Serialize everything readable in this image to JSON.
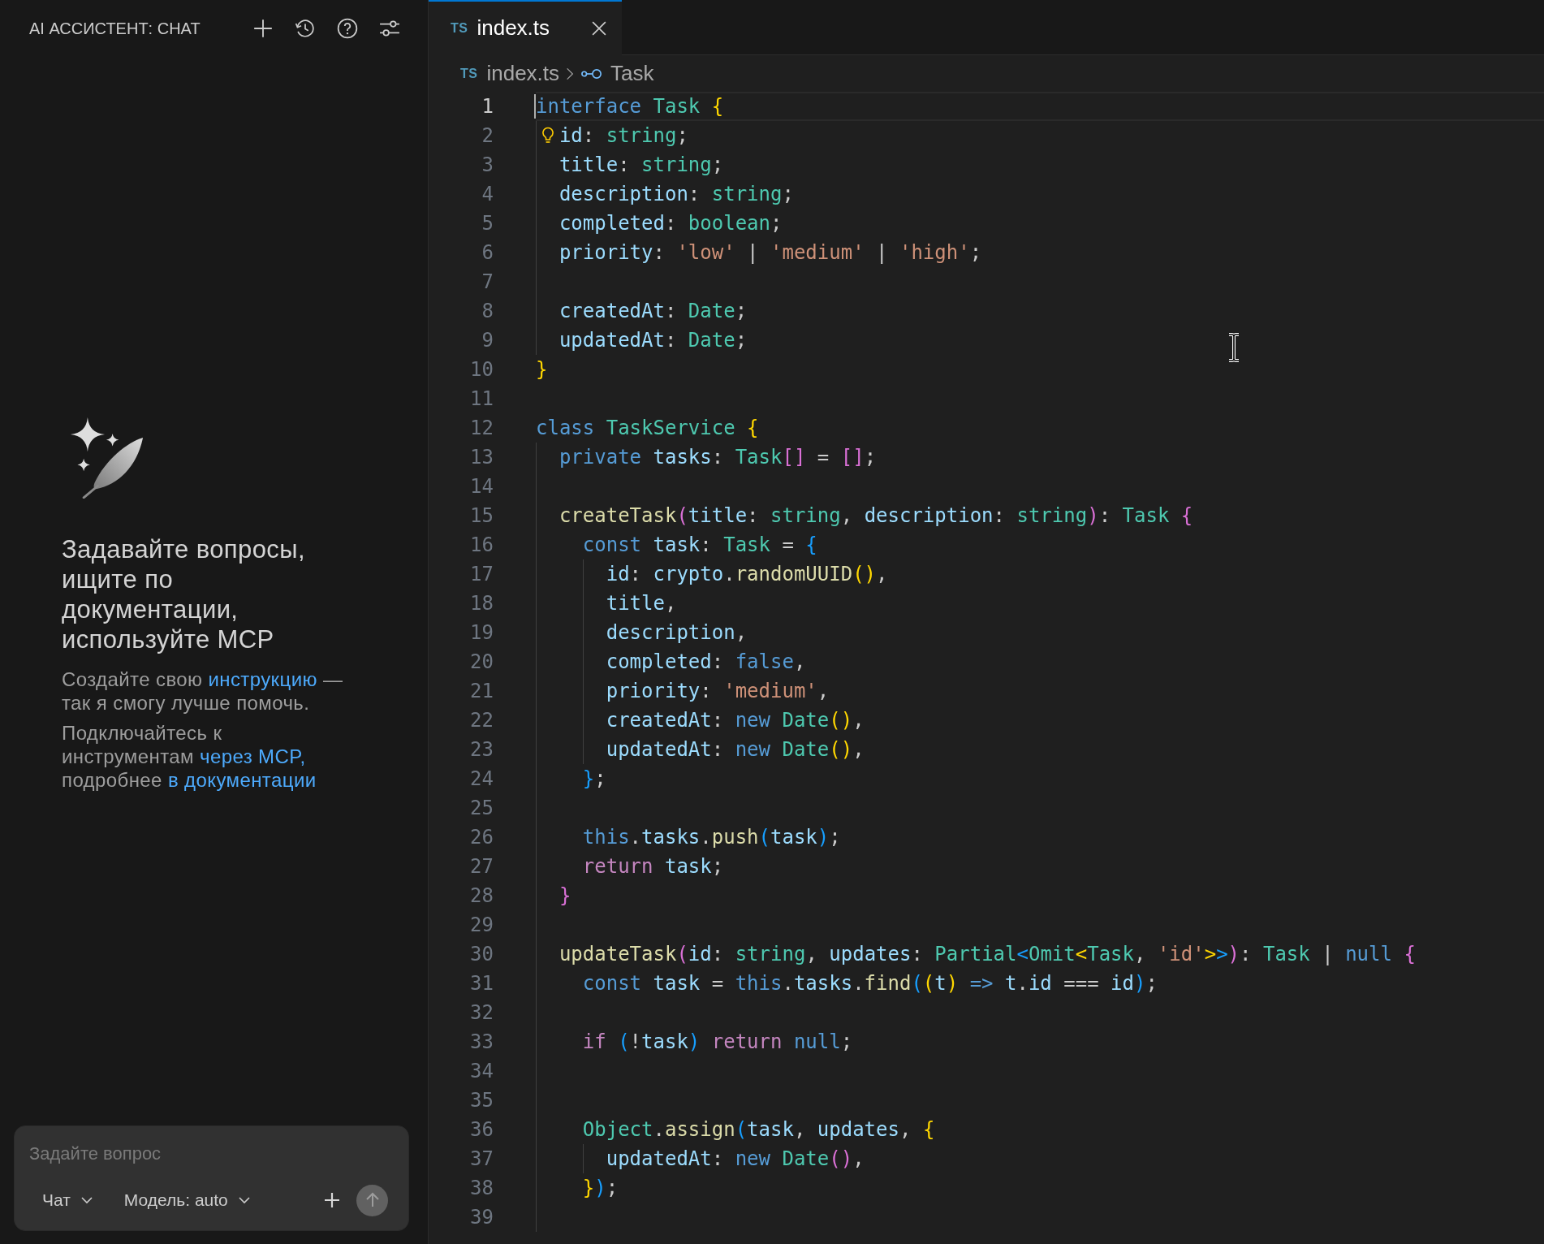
{
  "chat_panel": {
    "title": "AI АССИСТЕНТ: CHAT",
    "welcome": {
      "heading": "Задавайте вопросы, ищите по документации, используйте MCP",
      "paragraphs": [
        [
          {
            "kind": "text",
            "text": "Создайте свою "
          },
          {
            "kind": "link",
            "text": "инструкцию"
          },
          {
            "kind": "text",
            "text": " — так я смогу лучше помочь."
          }
        ],
        [
          {
            "kind": "text",
            "text": "Подключайтесь к инструментам "
          },
          {
            "kind": "link",
            "text": "через MCP,"
          },
          {
            "kind": "text",
            "text": " подробнее "
          },
          {
            "kind": "link",
            "text": "в документации"
          }
        ]
      ]
    },
    "composer": {
      "placeholder": "Задайте вопрос",
      "mode": "Чат",
      "model": "Модель: auto",
      "send_button": {
        "disabled": true
      }
    }
  },
  "editor": {
    "tabs": [
      {
        "file_type": "TS",
        "title": "index.ts",
        "selected": true
      }
    ],
    "breadcrumbs": [
      {
        "kind": "file",
        "file_type": "TS",
        "text": "index.ts"
      },
      {
        "kind": "symbol",
        "text": "Task"
      }
    ],
    "lines": [
      {
        "number": "1",
        "current": true,
        "lightbulb": false,
        "tokens": [
          {
            "kind": "keyword",
            "text": "interface "
          },
          {
            "kind": "type",
            "text": "Task "
          },
          {
            "kind": "bracket1",
            "text": "{"
          }
        ]
      },
      {
        "number": "2",
        "current": false,
        "lightbulb": true,
        "tokens": [
          {
            "kind": "variable",
            "text": "  id"
          },
          {
            "kind": "punct",
            "text": ": "
          },
          {
            "kind": "type",
            "text": "string"
          },
          {
            "kind": "punct",
            "text": ";"
          }
        ]
      },
      {
        "number": "3",
        "current": false,
        "lightbulb": false,
        "tokens": [
          {
            "kind": "variable",
            "text": "  title"
          },
          {
            "kind": "punct",
            "text": ": "
          },
          {
            "kind": "type",
            "text": "string"
          },
          {
            "kind": "punct",
            "text": ";"
          }
        ]
      },
      {
        "number": "4",
        "current": false,
        "lightbulb": false,
        "tokens": [
          {
            "kind": "variable",
            "text": "  description"
          },
          {
            "kind": "punct",
            "text": ": "
          },
          {
            "kind": "type",
            "text": "string"
          },
          {
            "kind": "punct",
            "text": ";"
          }
        ]
      },
      {
        "number": "5",
        "current": false,
        "lightbulb": false,
        "tokens": [
          {
            "kind": "variable",
            "text": "  completed"
          },
          {
            "kind": "punct",
            "text": ": "
          },
          {
            "kind": "type",
            "text": "boolean"
          },
          {
            "kind": "punct",
            "text": ";"
          }
        ]
      },
      {
        "number": "6",
        "current": false,
        "lightbulb": false,
        "tokens": [
          {
            "kind": "variable",
            "text": "  priority"
          },
          {
            "kind": "punct",
            "text": ": "
          },
          {
            "kind": "string",
            "text": "'low'"
          },
          {
            "kind": "punct",
            "text": " | "
          },
          {
            "kind": "string",
            "text": "'medium'"
          },
          {
            "kind": "punct",
            "text": " | "
          },
          {
            "kind": "string",
            "text": "'high'"
          },
          {
            "kind": "punct",
            "text": ";"
          }
        ]
      },
      {
        "number": "7",
        "current": false,
        "lightbulb": false
      },
      {
        "number": "8",
        "current": false,
        "lightbulb": false,
        "tokens": [
          {
            "kind": "variable",
            "text": "  createdAt"
          },
          {
            "kind": "punct",
            "text": ": "
          },
          {
            "kind": "type",
            "text": "Date"
          },
          {
            "kind": "punct",
            "text": ";"
          }
        ]
      },
      {
        "number": "9",
        "current": false,
        "lightbulb": false,
        "tokens": [
          {
            "kind": "variable",
            "text": "  updatedAt"
          },
          {
            "kind": "punct",
            "text": ": "
          },
          {
            "kind": "type",
            "text": "Date"
          },
          {
            "kind": "punct",
            "text": ";"
          }
        ]
      },
      {
        "number": "10",
        "current": false,
        "lightbulb": false,
        "tokens": [
          {
            "kind": "bracket1",
            "text": "}"
          }
        ]
      },
      {
        "number": "11",
        "current": false,
        "lightbulb": false
      },
      {
        "number": "12",
        "current": false,
        "lightbulb": false,
        "tokens": [
          {
            "kind": "keyword",
            "text": "class "
          },
          {
            "kind": "type",
            "text": "TaskService "
          },
          {
            "kind": "bracket1",
            "text": "{"
          }
        ]
      },
      {
        "number": "13",
        "current": false,
        "lightbulb": false,
        "tokens": [
          {
            "kind": "keyword",
            "text": "  private "
          },
          {
            "kind": "variable",
            "text": "tasks"
          },
          {
            "kind": "punct",
            "text": ": "
          },
          {
            "kind": "type",
            "text": "Task"
          },
          {
            "kind": "bracket2",
            "text": "[]"
          },
          {
            "kind": "punct",
            "text": " = "
          },
          {
            "kind": "bracket2",
            "text": "[]"
          },
          {
            "kind": "punct",
            "text": ";"
          }
        ]
      },
      {
        "number": "14",
        "current": false,
        "lightbulb": false
      },
      {
        "number": "15",
        "current": false,
        "lightbulb": false,
        "tokens": [
          {
            "kind": "function",
            "text": "  createTask"
          },
          {
            "kind": "bracket2",
            "text": "("
          },
          {
            "kind": "variable",
            "text": "title"
          },
          {
            "kind": "punct",
            "text": ": "
          },
          {
            "kind": "type",
            "text": "string"
          },
          {
            "kind": "punct",
            "text": ", "
          },
          {
            "kind": "variable",
            "text": "description"
          },
          {
            "kind": "punct",
            "text": ": "
          },
          {
            "kind": "type",
            "text": "string"
          },
          {
            "kind": "bracket2",
            "text": ")"
          },
          {
            "kind": "punct",
            "text": ": "
          },
          {
            "kind": "type",
            "text": "Task "
          },
          {
            "kind": "bracket2",
            "text": "{"
          }
        ]
      },
      {
        "number": "16",
        "current": false,
        "lightbulb": false,
        "tokens": [
          {
            "kind": "keyword",
            "text": "    const "
          },
          {
            "kind": "variable",
            "text": "task"
          },
          {
            "kind": "punct",
            "text": ": "
          },
          {
            "kind": "type",
            "text": "Task "
          },
          {
            "kind": "punct",
            "text": "= "
          },
          {
            "kind": "bracket3",
            "text": "{"
          }
        ]
      },
      {
        "number": "17",
        "current": false,
        "lightbulb": false,
        "tokens": [
          {
            "kind": "variable",
            "text": "      id"
          },
          {
            "kind": "punct",
            "text": ": "
          },
          {
            "kind": "variable",
            "text": "crypto"
          },
          {
            "kind": "punct",
            "text": "."
          },
          {
            "kind": "function",
            "text": "randomUUID"
          },
          {
            "kind": "bracket1",
            "text": "()"
          },
          {
            "kind": "punct",
            "text": ","
          }
        ]
      },
      {
        "number": "18",
        "current": false,
        "lightbulb": false,
        "tokens": [
          {
            "kind": "variable",
            "text": "      title"
          },
          {
            "kind": "punct",
            "text": ","
          }
        ]
      },
      {
        "number": "19",
        "current": false,
        "lightbulb": false,
        "tokens": [
          {
            "kind": "variable",
            "text": "      description"
          },
          {
            "kind": "punct",
            "text": ","
          }
        ]
      },
      {
        "number": "20",
        "current": false,
        "lightbulb": false,
        "tokens": [
          {
            "kind": "variable",
            "text": "      completed"
          },
          {
            "kind": "punct",
            "text": ": "
          },
          {
            "kind": "keyword",
            "text": "false"
          },
          {
            "kind": "punct",
            "text": ","
          }
        ]
      },
      {
        "number": "21",
        "current": false,
        "lightbulb": false,
        "tokens": [
          {
            "kind": "variable",
            "text": "      priority"
          },
          {
            "kind": "punct",
            "text": ": "
          },
          {
            "kind": "string",
            "text": "'medium'"
          },
          {
            "kind": "punct",
            "text": ","
          }
        ]
      },
      {
        "number": "22",
        "current": false,
        "lightbulb": false,
        "tokens": [
          {
            "kind": "variable",
            "text": "      createdAt"
          },
          {
            "kind": "punct",
            "text": ": "
          },
          {
            "kind": "keyword",
            "text": "new "
          },
          {
            "kind": "type",
            "text": "Date"
          },
          {
            "kind": "bracket1",
            "text": "()"
          },
          {
            "kind": "punct",
            "text": ","
          }
        ]
      },
      {
        "number": "23",
        "current": false,
        "lightbulb": false,
        "tokens": [
          {
            "kind": "variable",
            "text": "      updatedAt"
          },
          {
            "kind": "punct",
            "text": ": "
          },
          {
            "kind": "keyword",
            "text": "new "
          },
          {
            "kind": "type",
            "text": "Date"
          },
          {
            "kind": "bracket1",
            "text": "()"
          },
          {
            "kind": "punct",
            "text": ","
          }
        ]
      },
      {
        "number": "24",
        "current": false,
        "lightbulb": false,
        "tokens": [
          {
            "kind": "bracket3",
            "text": "    }"
          },
          {
            "kind": "punct",
            "text": ";"
          }
        ]
      },
      {
        "number": "25",
        "current": false,
        "lightbulb": false
      },
      {
        "number": "26",
        "current": false,
        "lightbulb": false,
        "tokens": [
          {
            "kind": "keyword",
            "text": "    this"
          },
          {
            "kind": "punct",
            "text": "."
          },
          {
            "kind": "variable",
            "text": "tasks"
          },
          {
            "kind": "punct",
            "text": "."
          },
          {
            "kind": "function",
            "text": "push"
          },
          {
            "kind": "bracket3",
            "text": "("
          },
          {
            "kind": "variable",
            "text": "task"
          },
          {
            "kind": "bracket3",
            "text": ")"
          },
          {
            "kind": "punct",
            "text": ";"
          }
        ]
      },
      {
        "number": "27",
        "current": false,
        "lightbulb": false,
        "tokens": [
          {
            "kind": "control",
            "text": "    return "
          },
          {
            "kind": "variable",
            "text": "task"
          },
          {
            "kind": "punct",
            "text": ";"
          }
        ]
      },
      {
        "number": "28",
        "current": false,
        "lightbulb": false,
        "tokens": [
          {
            "kind": "bracket2",
            "text": "  }"
          }
        ]
      },
      {
        "number": "29",
        "current": false,
        "lightbulb": false
      },
      {
        "number": "30",
        "current": false,
        "lightbulb": false,
        "tokens": [
          {
            "kind": "function",
            "text": "  updateTask"
          },
          {
            "kind": "bracket2",
            "text": "("
          },
          {
            "kind": "variable",
            "text": "id"
          },
          {
            "kind": "punct",
            "text": ": "
          },
          {
            "kind": "type",
            "text": "string"
          },
          {
            "kind": "punct",
            "text": ", "
          },
          {
            "kind": "variable",
            "text": "updates"
          },
          {
            "kind": "punct",
            "text": ": "
          },
          {
            "kind": "type",
            "text": "Partial"
          },
          {
            "kind": "bracket3",
            "text": "<"
          },
          {
            "kind": "type",
            "text": "Omit"
          },
          {
            "kind": "bracket1",
            "text": "<"
          },
          {
            "kind": "type",
            "text": "Task"
          },
          {
            "kind": "punct",
            "text": ", "
          },
          {
            "kind": "string",
            "text": "'id'"
          },
          {
            "kind": "bracket1",
            "text": ">"
          },
          {
            "kind": "bracket3",
            "text": ">"
          },
          {
            "kind": "bracket2",
            "text": ")"
          },
          {
            "kind": "punct",
            "text": ": "
          },
          {
            "kind": "type",
            "text": "Task "
          },
          {
            "kind": "punct",
            "text": "| "
          },
          {
            "kind": "keyword",
            "text": "null "
          },
          {
            "kind": "bracket2",
            "text": "{"
          }
        ]
      },
      {
        "number": "31",
        "current": false,
        "lightbulb": false,
        "tokens": [
          {
            "kind": "keyword",
            "text": "    const "
          },
          {
            "kind": "variable",
            "text": "task"
          },
          {
            "kind": "punct",
            "text": " = "
          },
          {
            "kind": "keyword",
            "text": "this"
          },
          {
            "kind": "punct",
            "text": "."
          },
          {
            "kind": "variable",
            "text": "tasks"
          },
          {
            "kind": "punct",
            "text": "."
          },
          {
            "kind": "function",
            "text": "find"
          },
          {
            "kind": "bracket3",
            "text": "("
          },
          {
            "kind": "bracket1",
            "text": "("
          },
          {
            "kind": "variable",
            "text": "t"
          },
          {
            "kind": "bracket1",
            "text": ")"
          },
          {
            "kind": "keyword",
            "text": " => "
          },
          {
            "kind": "variable",
            "text": "t"
          },
          {
            "kind": "punct",
            "text": "."
          },
          {
            "kind": "variable",
            "text": "id"
          },
          {
            "kind": "punct",
            "text": " === "
          },
          {
            "kind": "variable",
            "text": "id"
          },
          {
            "kind": "bracket3",
            "text": ")"
          },
          {
            "kind": "punct",
            "text": ";"
          }
        ]
      },
      {
        "number": "32",
        "current": false,
        "lightbulb": false
      },
      {
        "number": "33",
        "current": false,
        "lightbulb": false,
        "tokens": [
          {
            "kind": "control",
            "text": "    if "
          },
          {
            "kind": "bracket3",
            "text": "("
          },
          {
            "kind": "punct",
            "text": "!"
          },
          {
            "kind": "variable",
            "text": "task"
          },
          {
            "kind": "bracket3",
            "text": ")"
          },
          {
            "kind": "control",
            "text": " return "
          },
          {
            "kind": "keyword",
            "text": "null"
          },
          {
            "kind": "punct",
            "text": ";"
          }
        ]
      },
      {
        "number": "34",
        "current": false,
        "lightbulb": false
      },
      {
        "number": "35",
        "current": false,
        "lightbulb": false
      },
      {
        "number": "36",
        "current": false,
        "lightbulb": false,
        "tokens": [
          {
            "kind": "type",
            "text": "    Object"
          },
          {
            "kind": "punct",
            "text": "."
          },
          {
            "kind": "function",
            "text": "assign"
          },
          {
            "kind": "bracket3",
            "text": "("
          },
          {
            "kind": "variable",
            "text": "task"
          },
          {
            "kind": "punct",
            "text": ", "
          },
          {
            "kind": "variable",
            "text": "updates"
          },
          {
            "kind": "punct",
            "text": ", "
          },
          {
            "kind": "bracket1",
            "text": "{"
          }
        ]
      },
      {
        "number": "37",
        "current": false,
        "lightbulb": false,
        "tokens": [
          {
            "kind": "variable",
            "text": "      updatedAt"
          },
          {
            "kind": "punct",
            "text": ": "
          },
          {
            "kind": "keyword",
            "text": "new "
          },
          {
            "kind": "type",
            "text": "Date"
          },
          {
            "kind": "bracket2",
            "text": "()"
          },
          {
            "kind": "punct",
            "text": ","
          }
        ]
      },
      {
        "number": "38",
        "current": false,
        "lightbulb": false,
        "tokens": [
          {
            "kind": "bracket1",
            "text": "    }"
          },
          {
            "kind": "bracket3",
            "text": ")"
          },
          {
            "kind": "punct",
            "text": ";"
          }
        ]
      },
      {
        "number": "39",
        "current": false,
        "lightbulb": false
      }
    ]
  }
}
